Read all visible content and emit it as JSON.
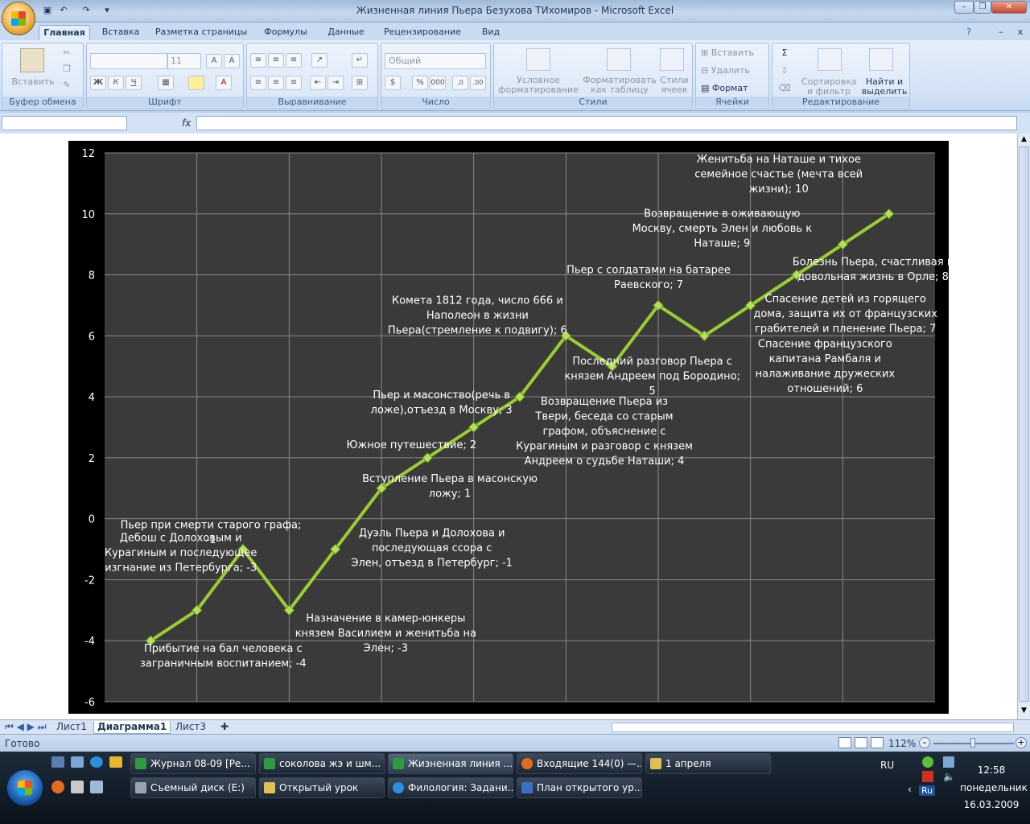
{
  "window": {
    "title": "Жизненная линия Пьера Безухова ТИхомиров - Microsoft Excel"
  },
  "ribbon": {
    "tabs": [
      "Главная",
      "Вставка",
      "Разметка страницы",
      "Формулы",
      "Данные",
      "Рецензирование",
      "Вид"
    ],
    "clipboard": {
      "paste": "Вставить",
      "group": "Буфер обмена"
    },
    "font": {
      "size": "11",
      "group": "Шрифт"
    },
    "alignment": {
      "group": "Выравнивание"
    },
    "number": {
      "format": "Общий",
      "group": "Число"
    },
    "styles": {
      "conditional": "Условное форматирование",
      "as_table": "Форматировать как таблицу",
      "cell_styles": "Стили ячеек",
      "group": "Стили"
    },
    "cells": {
      "insert": "Вставить",
      "delete": "Удалить",
      "format": "Формат",
      "group": "Ячейки"
    },
    "editing": {
      "sort": "Сортировка и фильтр",
      "find": "Найти и выделить",
      "group": "Редактирование"
    }
  },
  "formula_bar": {
    "fx": "fx"
  },
  "sheet_tabs": [
    "Лист1",
    "Диаграмма1",
    "Лист3"
  ],
  "status": {
    "ready": "Готово",
    "zoom": "112%"
  },
  "taskbar": {
    "row1": [
      "Журнал 08-09 [Ре...",
      "соколова жэ и шм...",
      "Жизненная линия ...",
      "Входящие 144(0) —...",
      "1 апреля"
    ],
    "row2": [
      "Съемный диск (E:)",
      "Открытый урок",
      "Филология: Задани...",
      "План открытого ур..."
    ],
    "lang": "RU",
    "lang2": "Ru",
    "time": "12:58",
    "day": "понедельник",
    "date": "16.03.2009"
  },
  "colors": {
    "line": "#9acd32",
    "plot_bg": "#3a3a3a",
    "chart_bg": "#000000",
    "grid": "#8a8a8a"
  },
  "chart_data": {
    "type": "line",
    "ylim": [
      -6,
      12
    ],
    "yticks": [
      "12",
      "10",
      "8",
      "6",
      "4",
      "2",
      "0",
      "-2",
      "-4",
      "-6"
    ],
    "grid": true,
    "values": [
      -4,
      -3,
      -1,
      -3,
      -1,
      1,
      2,
      3,
      4,
      6,
      5,
      7,
      6,
      7,
      8,
      9,
      10
    ],
    "labels": [
      [
        "Прибытие на бал человека с",
        "заграничным воспитанием; -4"
      ],
      [
        "Дебош с Долоховым и",
        "Курагиным и последующее",
        "изгнание из Петербурга; -3"
      ],
      [
        "Пьер при смерти старого графа;",
        "-1"
      ],
      [
        "Назначение в камер-юнкеры",
        "князем Василием и женитьба на",
        "Элен; -3"
      ],
      [
        "Дуэль Пьера и Долохова и",
        "последующая ссора с",
        "Элен, отъезд в Петербург; -1"
      ],
      [
        "Вступление Пьера в масонскую",
        "ложу; 1"
      ],
      [
        "Южное путешествие; 2"
      ],
      [
        "Пьер и масонство(речь в",
        "ложе),отъезд в Москву; 3"
      ],
      [
        "Возвращение Пьера из",
        "Твери, беседа со старым",
        "графом, объяснение с",
        "Курагиным и разговор с князем",
        "Андреем  о судьбе Наташи; 4"
      ],
      [
        "Комета 1812  года, число 666  и",
        "Наполеон в жизни",
        "Пьера(стремление к подвигу); 6"
      ],
      [
        "Последний разговор Пьера с",
        "князем Андреем под Бородино;",
        "5"
      ],
      [
        "Пьер с солдатами на батарее",
        "Раевского; 7"
      ],
      [
        "Спасение французского",
        "капитана Рамбаля и",
        "налаживание дружеских",
        "отношений; 6"
      ],
      [
        "Спасение детей из горящего",
        "дома, защита их от французских",
        "грабителей и пленение Пьера; 7"
      ],
      [
        "Болезнь Пьера, счастливая и",
        "довольная жизнь в Орле; 8"
      ],
      [
        "Возвращение в оживающую",
        "Москву, смерть Элен и любовь к",
        "Наташе; 9"
      ],
      [
        "Женитьба на Наташе и тихое",
        "семейное счастье (мечта всей",
        "жизни); 10"
      ]
    ]
  }
}
